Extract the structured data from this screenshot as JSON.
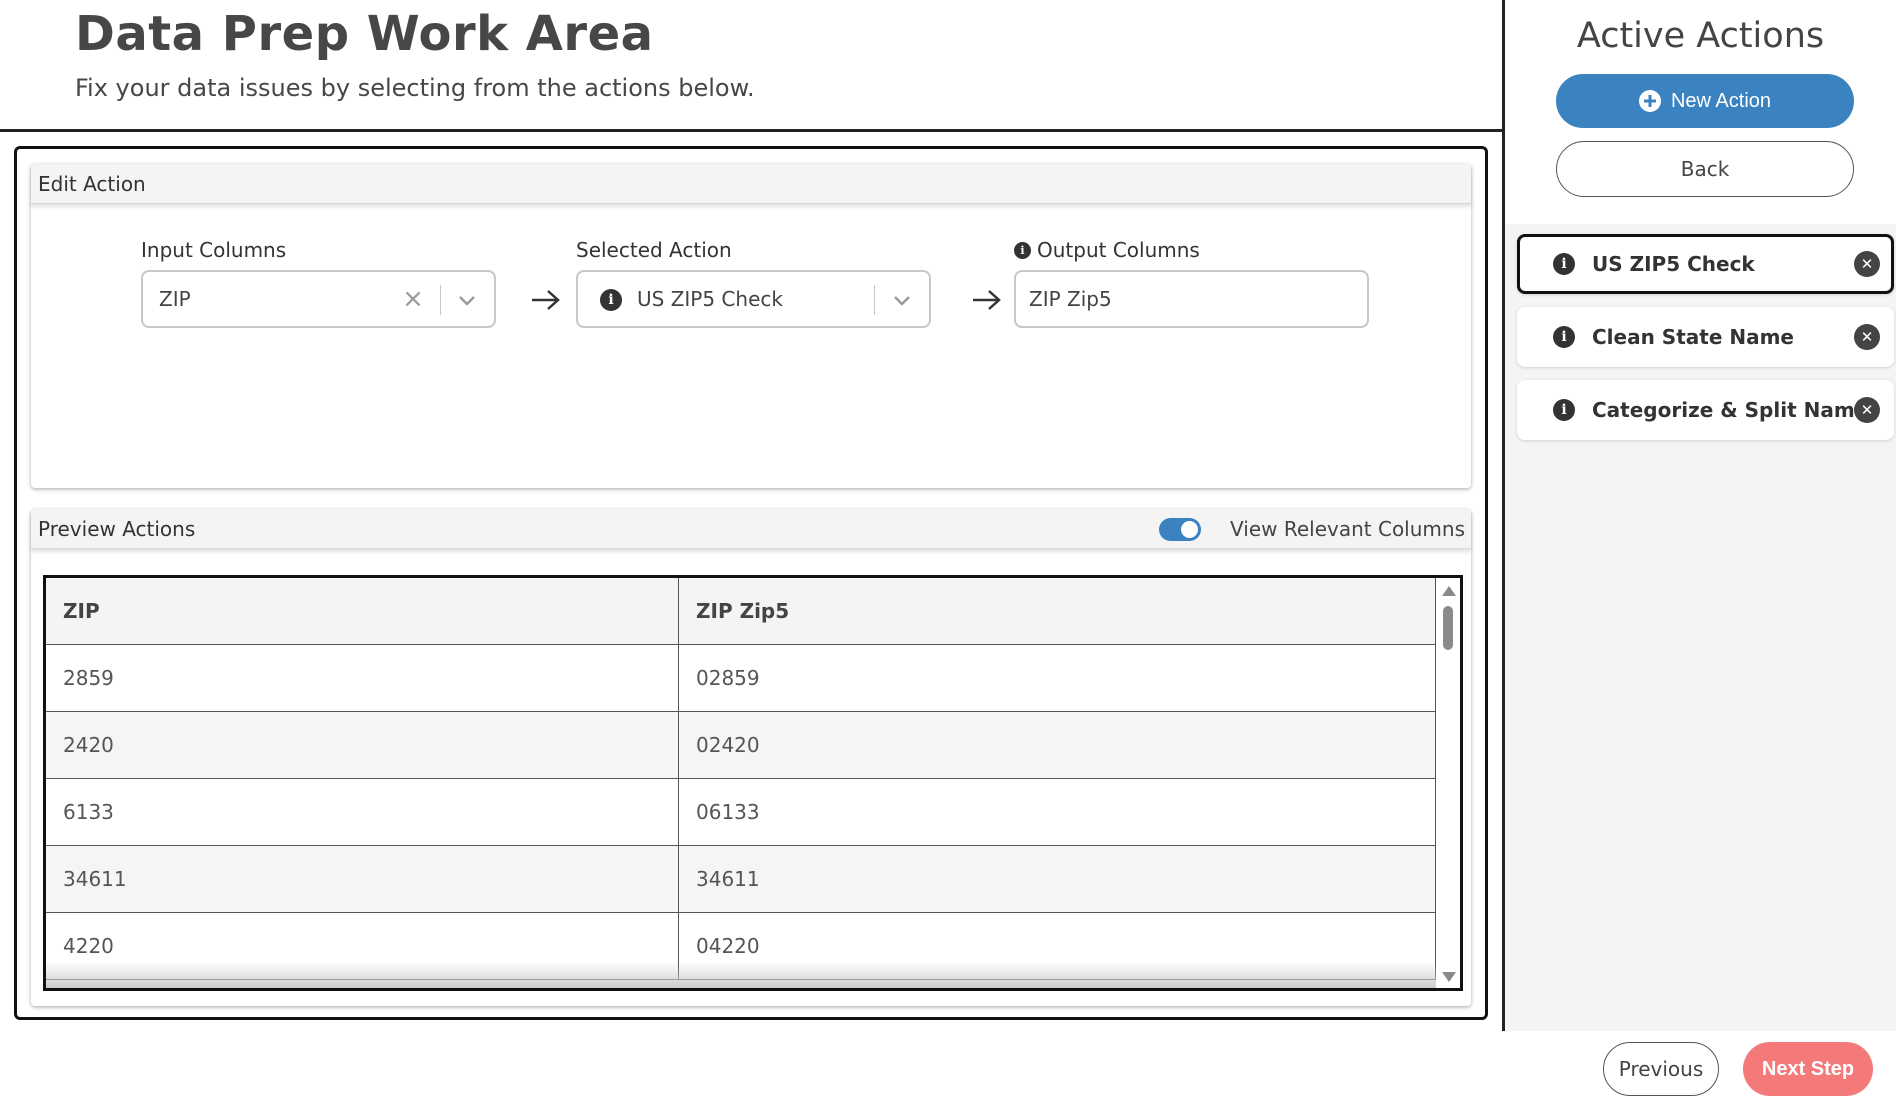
{
  "header": {
    "title": "Data Prep Work Area",
    "subtitle": "Fix your data issues by selecting from the actions below."
  },
  "edit_action": {
    "panel_title": "Edit Action",
    "input_columns_label": "Input Columns",
    "input_columns_value": "ZIP",
    "selected_action_label": "Selected Action",
    "selected_action_value": "US ZIP5 Check",
    "output_columns_label": "Output Columns",
    "output_columns_value": "ZIP Zip5"
  },
  "preview": {
    "panel_title": "Preview Actions",
    "toggle_label": "View Relevant Columns",
    "toggle_on": true,
    "columns": [
      "ZIP",
      "ZIP Zip5"
    ],
    "rows": [
      [
        "2859",
        "02859"
      ],
      [
        "2420",
        "02420"
      ],
      [
        "6133",
        "06133"
      ],
      [
        "34611",
        "34611"
      ],
      [
        "4220",
        "04220"
      ]
    ]
  },
  "sidebar": {
    "title": "Active Actions",
    "new_action_label": "New Action",
    "back_label": "Back",
    "actions": [
      {
        "label": "US ZIP5 Check",
        "selected": true
      },
      {
        "label": "Clean State Name",
        "selected": false
      },
      {
        "label": "Categorize & Split Name",
        "selected": false
      }
    ]
  },
  "footer": {
    "previous_label": "Previous",
    "next_label": "Next Step"
  },
  "colors": {
    "primary": "#3a83c0",
    "next_button": "#f47a7a",
    "text": "#474747"
  }
}
